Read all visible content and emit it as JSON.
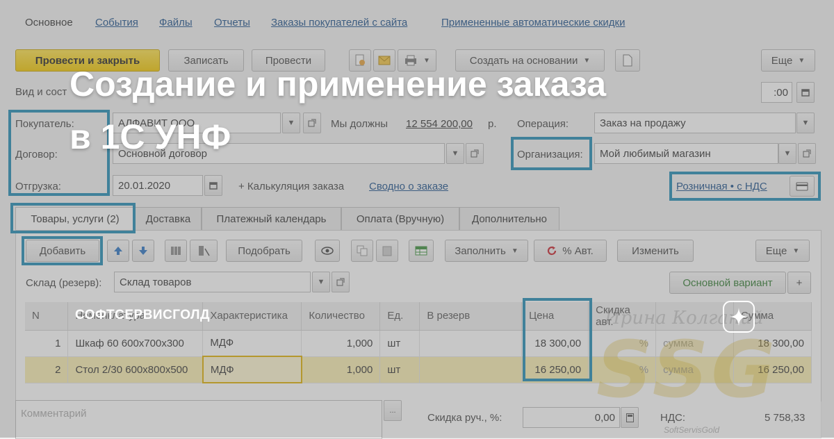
{
  "headline": {
    "line1": "Создание и применение заказа",
    "line2": "в 1С УНФ"
  },
  "brand": "СОФТСЕРВИСГОЛД",
  "top_tabs": [
    "Основное",
    "События",
    "Файлы",
    "Отчеты",
    "Заказы покупателей с сайта",
    "Примененные автоматические скидки"
  ],
  "toolbar": {
    "post_close": "Провести и закрыть",
    "save": "Записать",
    "post": "Провести",
    "create_based": "Создать на основании",
    "more": "Еще"
  },
  "form": {
    "kind_label": "Вид и сост",
    "date_tail": ":00",
    "buyer_label": "Покупатель:",
    "buyer_value": "АЛФАВИТ ООО",
    "debt_label": "Мы должны",
    "debt_value": "12 554 200,00",
    "debt_unit": "р.",
    "operation_label": "Операция:",
    "operation_value": "Заказ на продажу",
    "contract_label": "Договор:",
    "contract_value": "Основной договор",
    "org_label": "Организация:",
    "org_value": "Мой любимый магазин",
    "shipment_label": "Отгрузка:",
    "shipment_value": "20.01.2020",
    "calc_label": "+ Калькуляция заказа",
    "summary_link": "Сводно о заказе",
    "price_type_link": "Розничная • с НДС"
  },
  "tabs": [
    "Товары, услуги (2)",
    "Доставка",
    "Платежный календарь",
    "Оплата (Вручную)",
    "Дополнительно"
  ],
  "items_toolbar": {
    "add": "Добавить",
    "pick": "Подобрать",
    "fill": "Заполнить",
    "auto_pct": "% Авт.",
    "change": "Изменить",
    "more": "Еще"
  },
  "warehouse": {
    "label": "Склад (резерв):",
    "value": "Склад товаров",
    "variant": "Основной вариант",
    "plus": "+"
  },
  "table": {
    "headers": [
      "N",
      "Номенклатура",
      "Характеристика",
      "Количество",
      "Ед.",
      "В резерв",
      "Цена",
      "Скидка авт.",
      "",
      "Сумма"
    ],
    "rows": [
      [
        "1",
        "Шкаф 60 600х700х300",
        "МДФ",
        "1,000",
        "шт",
        "",
        "18 300,00",
        "%",
        "сумма",
        "18 300,00"
      ],
      [
        "2",
        "Стол 2/30 600х800х500",
        "МДФ",
        "1,000",
        "шт",
        "",
        "16 250,00",
        "%",
        "сумма",
        "16 250,00"
      ]
    ]
  },
  "bottom": {
    "comment_placeholder": "Комментарий",
    "manual_discount_label": "Скидка руч., %:",
    "manual_discount_value": "0,00",
    "vat_label": "НДС:",
    "vat_value": "5 758,33"
  },
  "watermark": {
    "script": "Ирина Колганий",
    "logo": "SSG",
    "small": "SoftServisGold"
  },
  "colors": {
    "highlight": "#1f8bb5",
    "primary_button": "#f2c700",
    "link": "#1a4f8a",
    "selected_row": "#fbefb1"
  }
}
